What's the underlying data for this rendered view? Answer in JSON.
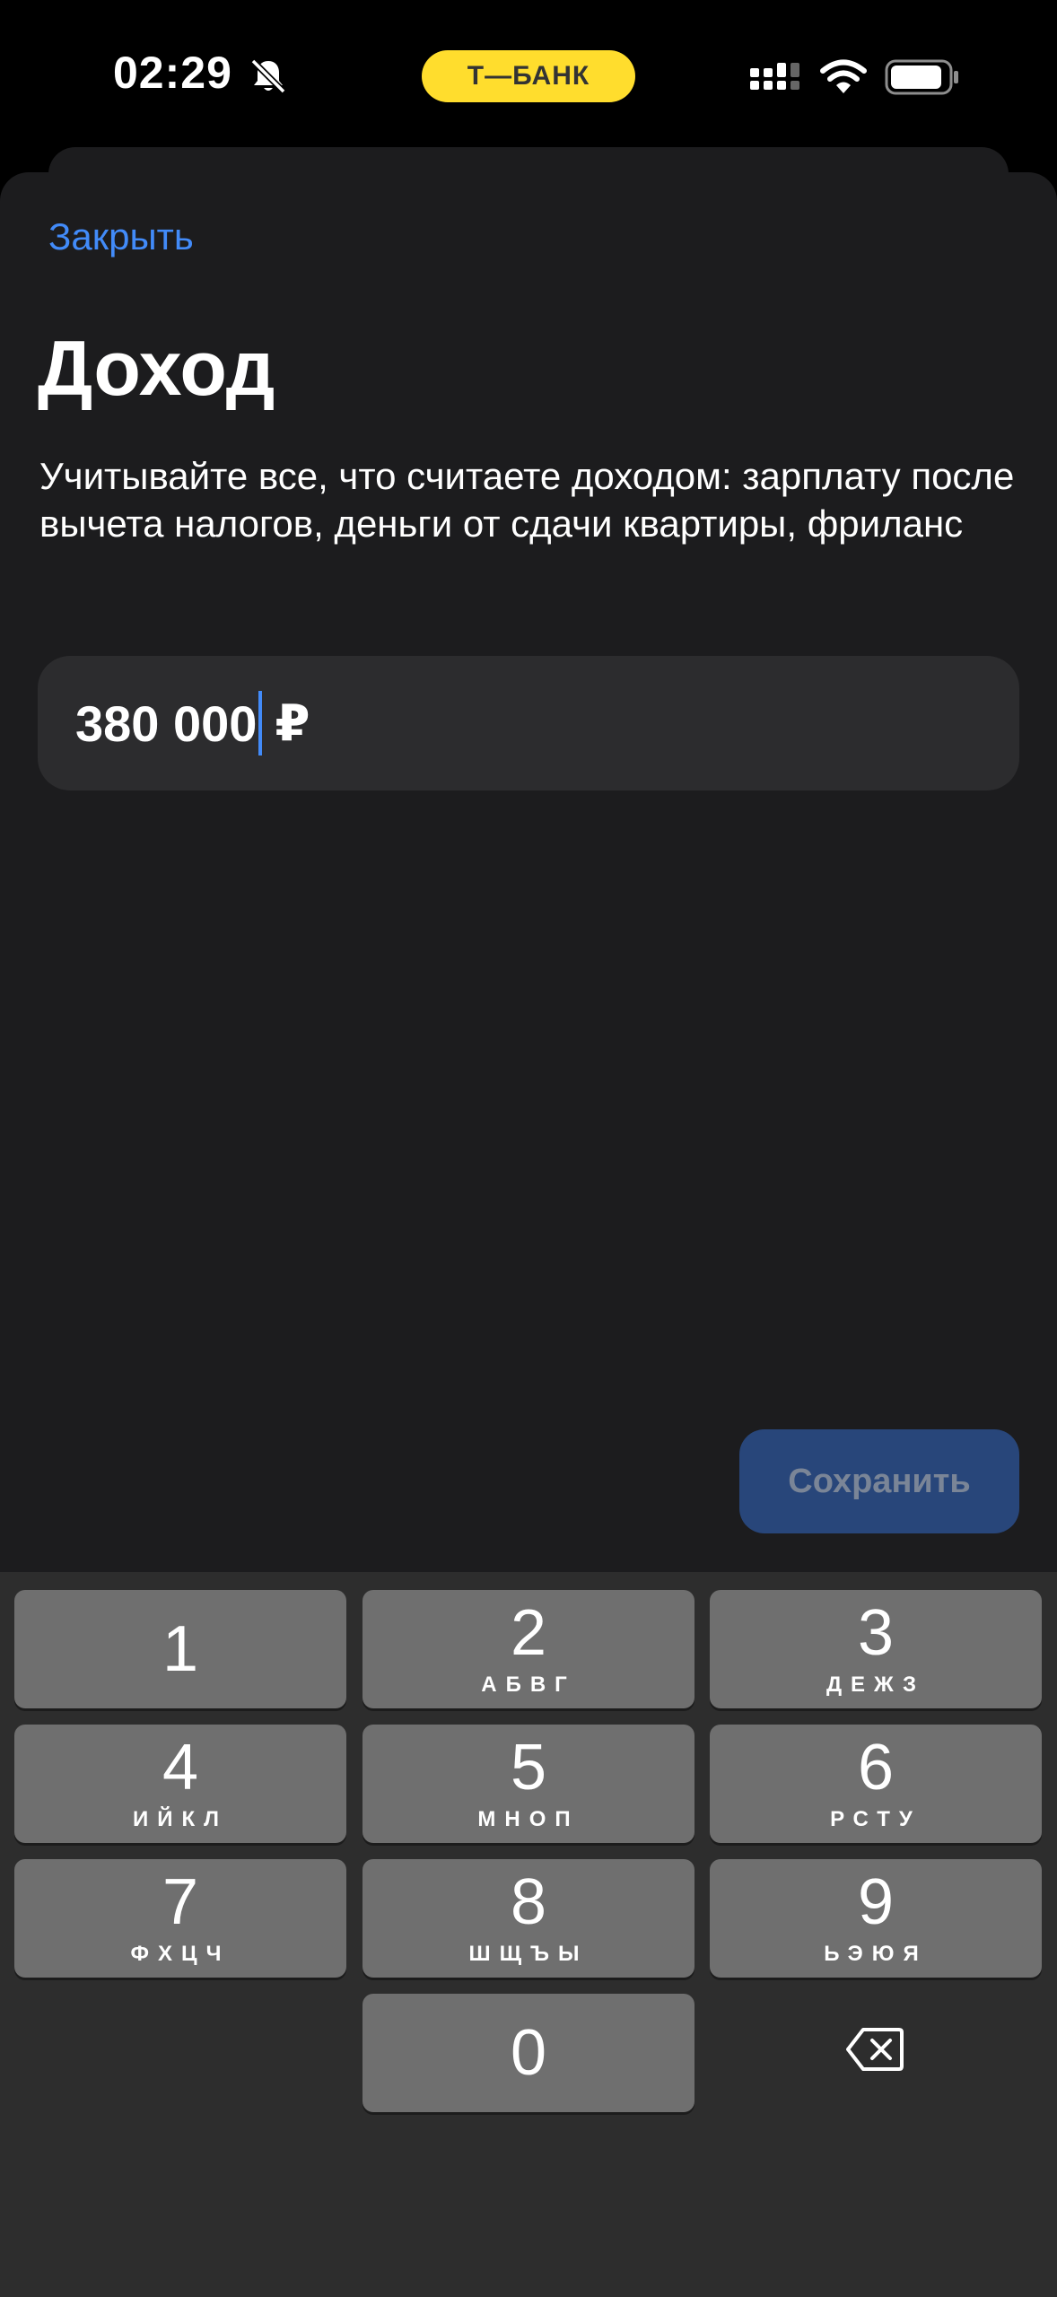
{
  "status_bar": {
    "time": "02:29",
    "pill_label": "Т—БАНК",
    "pill_color": "#ffdd2d",
    "icons": [
      "bell-muted-icon",
      "cellular-signal-icon",
      "wifi-icon",
      "battery-icon"
    ]
  },
  "header": {
    "close_label": "Закрыть",
    "title": "Доход"
  },
  "description": "Учитывайте все, что считаете доходом: зарплату после вычета налогов, деньги от сдачи квартиры, фриланс",
  "amount_input": {
    "value": "380 000",
    "currency": "₽"
  },
  "save_label": "Сохранить",
  "keypad": {
    "keys": [
      {
        "digit": "1",
        "letters": ""
      },
      {
        "digit": "2",
        "letters": "АБВГ"
      },
      {
        "digit": "3",
        "letters": "ДЕЖЗ"
      },
      {
        "digit": "4",
        "letters": "ИЙКЛ"
      },
      {
        "digit": "5",
        "letters": "МНОП"
      },
      {
        "digit": "6",
        "letters": "РСТУ"
      },
      {
        "digit": "7",
        "letters": "ФХЦЧ"
      },
      {
        "digit": "8",
        "letters": "ШЩЪЫ"
      },
      {
        "digit": "9",
        "letters": "ЬЭЮЯ"
      },
      {
        "digit": "0",
        "letters": ""
      }
    ],
    "backspace_icon": "backspace-icon"
  },
  "colors": {
    "accent": "#428bf9",
    "background": "#1c1c1e",
    "field": "#2c2c2e",
    "save_button": "#28467a"
  }
}
